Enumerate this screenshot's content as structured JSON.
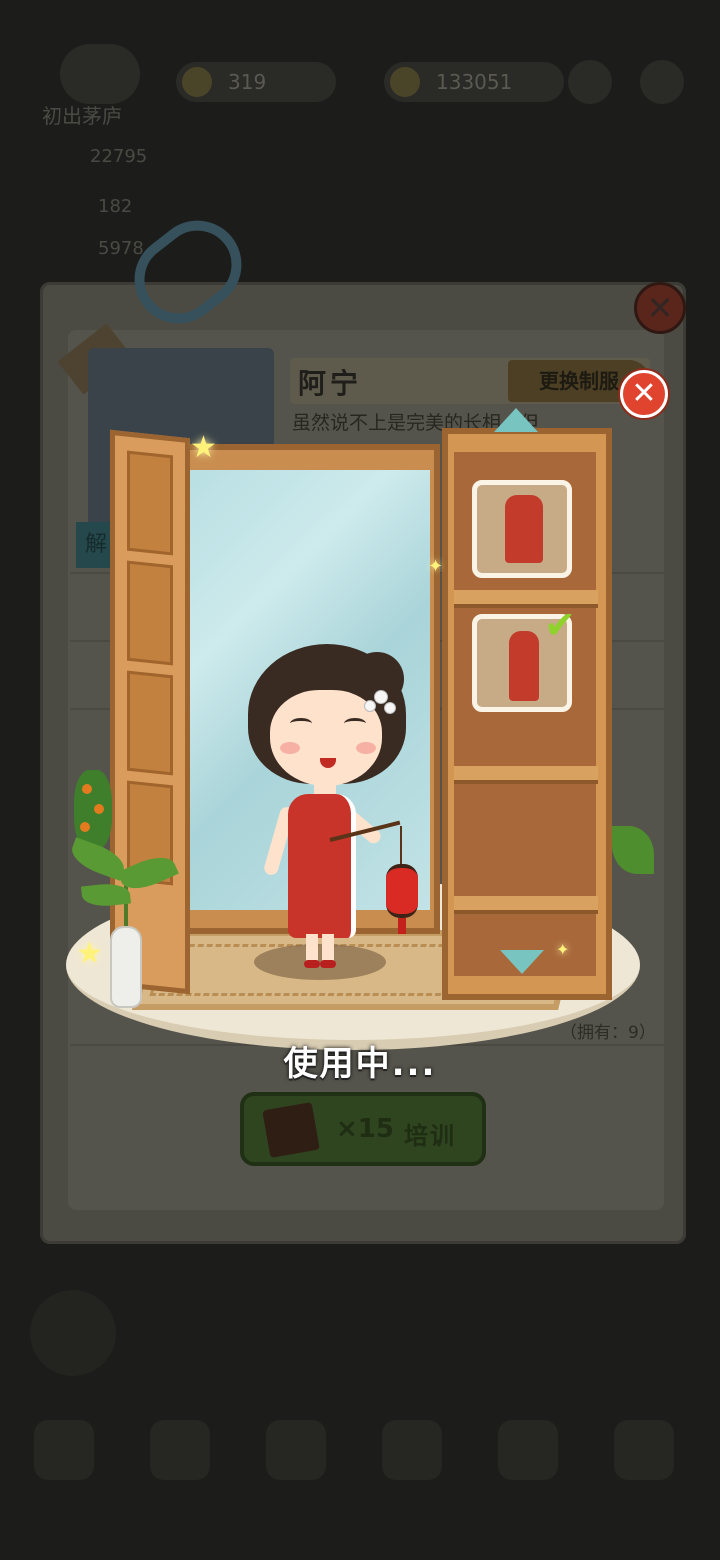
{
  "background_hud": {
    "resource_1": "319",
    "resource_2": "133051",
    "title": "初出茅庐",
    "money": "22795",
    "stat_1": "182",
    "stat_2": "5978"
  },
  "staff_card": {
    "name": "阿宁",
    "change_uniform_label": "更换制服",
    "description": "虽然说不上是完美的长相，但",
    "side_tag": "解",
    "note": "（拥有：9）"
  },
  "wardrobe": {
    "status_text": "使用中...",
    "outfits": [
      {
        "name": "red-qipao-short",
        "selected": false
      },
      {
        "name": "red-qipao-long",
        "selected": true
      }
    ]
  },
  "training_button": {
    "count": "×15",
    "label": "培训"
  },
  "colors": {
    "accent_red": "#e0442e",
    "check_green": "#8fd22b",
    "wood": "#d39653"
  }
}
